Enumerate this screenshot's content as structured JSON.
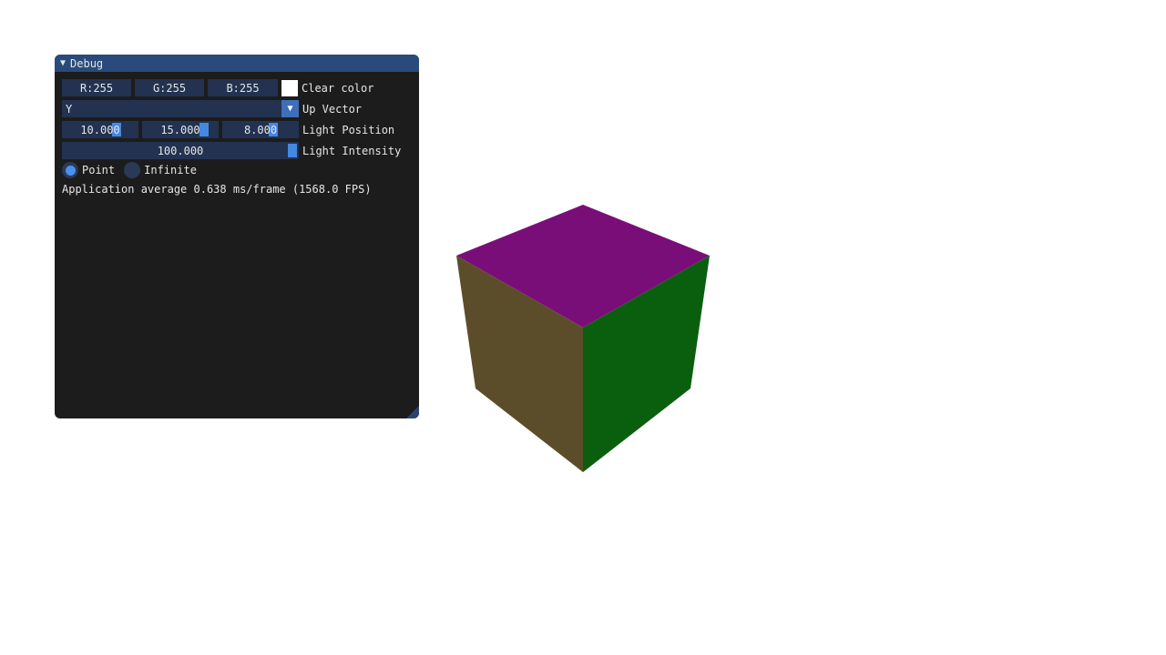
{
  "window": {
    "title": "Debug",
    "collapse_icon": "triangle-down-icon"
  },
  "clear_color": {
    "r_label": "R:255",
    "g_label": "G:255",
    "b_label": "B:255",
    "label": "Clear color",
    "color": "#ffffff"
  },
  "up_vector": {
    "value": "Y",
    "label": "Up Vector",
    "arrow_icon": "triangle-down-icon"
  },
  "light_position": {
    "x": "10.000",
    "y": "15.000",
    "z": "8.000",
    "label": "Light Position"
  },
  "light_intensity": {
    "value": "100.000",
    "label": "Light Intensity"
  },
  "light_type": {
    "options": [
      "Point",
      "Infinite"
    ],
    "selected": "Point"
  },
  "status": {
    "text": "Application average 0.638 ms/frame (1568.0 FPS)"
  },
  "colors": {
    "title_bar": "#294a7a",
    "window_bg": "#1c1c1c",
    "frame_bg": "#223250",
    "accent": "#4588e0",
    "cube_top": "#7a0e79",
    "cube_left": "#5c4d2a",
    "cube_right": "#0a5f0e"
  }
}
